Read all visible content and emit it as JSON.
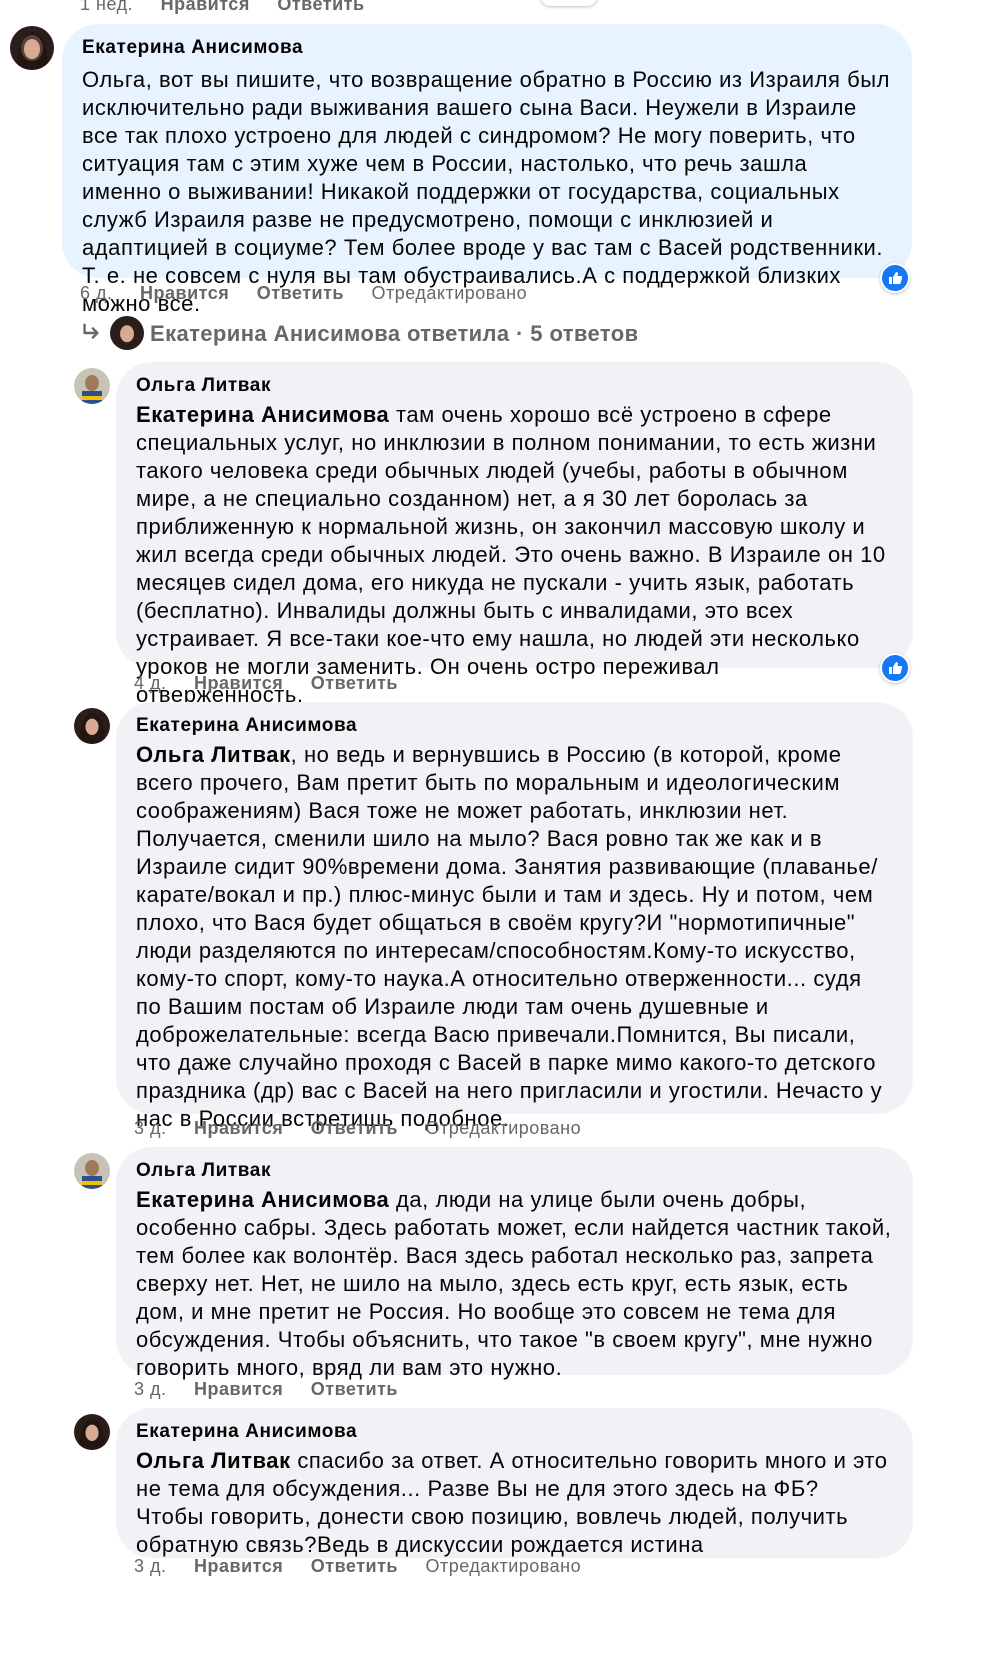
{
  "top_meta": {
    "time": "1 нед.",
    "like": "Нравится",
    "reply": "Ответить"
  },
  "thread_replies": {
    "text": "Екатерина Анисимова ответила · 5 ответов",
    "icon": "reply-arrow-icon"
  },
  "colors": {
    "bubble": "#f0f2f5",
    "bubble_highlight": "#e7f3ff",
    "meta": "#65676b",
    "like_badge": "#1877f2"
  },
  "comments": [
    {
      "author": "Екатерина Анисимова",
      "mention": "",
      "text": "Ольга, вот вы пишите, что возвращение обратно в Россию из Израиля был исключительно ради выживания вашего сына Васи. Неужели в Израиле все так плохо устроено для людей с синдромом? Не могу поверить, что ситуация там с этим хуже чем в России, настолько, что речь зашла именно о выживании! Никакой поддержки от государства, социальных служб Израиля разве не предусмотрено, помощи с инклюзией и адаптицией в социуме? Тем более вроде у вас там с Васей родственники. Т. е. не совсем с нуля вы там обустраивались.А с поддержкой близких можно все.",
      "time": "6 д.",
      "like": "Нравится",
      "reply": "Ответить",
      "edited": "Отредактировано",
      "reactions": "like"
    },
    {
      "author": "Ольга Литвак",
      "mention": "Екатерина Анисимова",
      "text": " там очень хорошо всё устроено в сфере специальных услуг, но инклюзии в полном понимании, то есть жизни такого человека среди обычных людей (учебы, работы в обычном мире, а не специально созданном) нет, а я 30 лет боролась за приближенную к нормальной жизнь, он закончил массовую школу и жил всегда среди обычных людей. Это очень важно. В Израиле он 10 месяцев сидел дома, его никуда не пускали - учить язык, работать (бесплатно). Инвалиды должны быть с инвалидами, это всех устраивает. Я все-таки кое-что ему нашла, но людей эти несколько уроков не могли заменить. Он очень остро переживал отверженность.",
      "time": "4 д.",
      "like": "Нравится",
      "reply": "Ответить",
      "edited": "",
      "reactions": "like"
    },
    {
      "author": "Екатерина Анисимова",
      "mention": "Ольга Литвак",
      "text": ", но ведь и вернувшись в Россию (в которой, кроме всего прочего, Вам претит быть по моральным и идеологическим соображениям) Вася тоже не может работать, инклюзии нет. Получается, сменили шило на мыло? Вася ровно так же как и в Израиле сидит 90%времени дома. Занятия развивающие (плаванье/ карате/вокал и пр.) плюс-минус были и там и здесь. Ну и потом, чем плохо, что Вася будет общаться в своём кругу?И \"нормотипичные\" люди разделяются по интересам/способностям.Кому-то искусство, кому-то спорт, кому-то наука.А относительно отверженности... судя по Вашим постам об Израиле люди там очень душевные и доброжелательные: всегда Васю привечали.Помнится, Вы писали, что даже случайно проходя с Васей в парке мимо какого-то детского праздника (др) вас с Васей на него пригласили и угостили. Нечасто у нас в России встретишь подобное.",
      "time": "3 д.",
      "like": "Нравится",
      "reply": "Ответить",
      "edited": "Отредактировано",
      "reactions": ""
    },
    {
      "author": "Ольга Литвак",
      "mention": "Екатерина Анисимова",
      "text": " да, люди на улице были очень добры, особенно сабры. Здесь работать может, если найдется частник такой, тем более как волонтёр. Вася здесь работал несколько раз, запрета сверху нет. Нет, не шило на мыло, здесь есть круг, есть язык, есть дом, и мне претит не Россия. Но вообще это совсем не тема для обсуждения. Чтобы объяснить, что такое \"в своем кругу\", мне нужно говорить много, вряд ли вам это нужно.",
      "time": "3 д.",
      "like": "Нравится",
      "reply": "Ответить",
      "edited": "",
      "reactions": ""
    },
    {
      "author": "Екатерина Анисимова",
      "mention": "Ольга Литвак",
      "text": " спасибо за ответ. А относительно говорить много и это не тема для обсуждения... Разве Вы не для этого здесь на ФБ? Чтобы говорить, донести свою позицию, вовлечь людей, получить обратную связь?Ведь в дискуссии рождается истина",
      "time": "3 д.",
      "like": "Нравится",
      "reply": "Ответить",
      "edited": "Отредактировано",
      "reactions": ""
    }
  ]
}
